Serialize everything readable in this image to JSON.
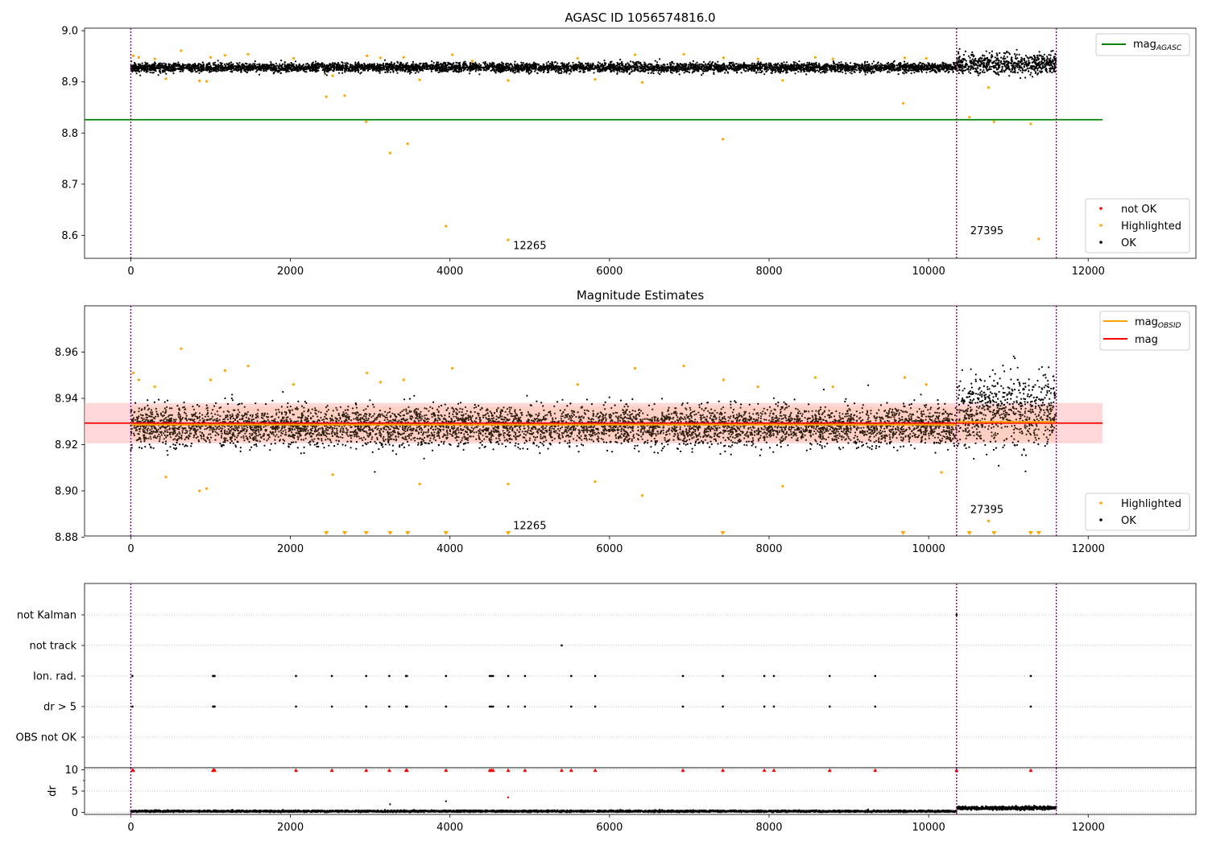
{
  "figure": {
    "main_title": "AGASC ID 1056574816.0",
    "mid_title": "Magnitude Estimates"
  },
  "colors": {
    "ok": "#000000",
    "highlighted": "#ffa500",
    "not_ok": "#ff0000",
    "mag_agasc": "#008000",
    "mag_obsid": "#ffa500",
    "mag": "#ff0000",
    "obs_boundary": "#800080",
    "band": "#ffc0c0"
  },
  "chart_data": [
    {
      "id": "top",
      "type": "scatter",
      "title": "AGASC ID 1056574816.0",
      "xlim": [
        -580,
        13350
      ],
      "ylim": [
        8.555,
        9.005
      ],
      "xticks": [
        0,
        2000,
        4000,
        6000,
        8000,
        10000,
        12000
      ],
      "yticks": [
        8.6,
        8.7,
        8.8,
        8.9,
        9.0
      ],
      "ytick_labels": [
        "8.6",
        "8.7",
        "8.8",
        "8.9",
        "9.0"
      ],
      "obs_boundaries": [
        0,
        10350,
        11600
      ],
      "obs_labels": [
        {
          "text": "12265",
          "x": 5000,
          "y": 8.573
        },
        {
          "text": "27395",
          "x": 10730,
          "y": 8.602
        }
      ],
      "mag_agasc": {
        "y": 8.826,
        "x": [
          -580,
          12180
        ]
      },
      "ok_series": {
        "segments": [
          {
            "x0": 0,
            "x1": 10350,
            "center": 8.928,
            "spread": 0.008
          },
          {
            "x0": 10350,
            "x1": 11600,
            "center": 8.935,
            "spread": 0.018
          }
        ]
      },
      "highlighted": [
        [
          30,
          8.951
        ],
        [
          100,
          8.948
        ],
        [
          300,
          8.945
        ],
        [
          440,
          8.906
        ],
        [
          630,
          8.961
        ],
        [
          860,
          8.902
        ],
        [
          950,
          8.901
        ],
        [
          1000,
          8.948
        ],
        [
          1180,
          8.952
        ],
        [
          1470,
          8.954
        ],
        [
          2040,
          8.946
        ],
        [
          2450,
          8.871
        ],
        [
          2530,
          8.912
        ],
        [
          2680,
          8.873
        ],
        [
          2950,
          8.822
        ],
        [
          2960,
          8.951
        ],
        [
          3130,
          8.947
        ],
        [
          3250,
          8.761
        ],
        [
          3420,
          8.948
        ],
        [
          3470,
          8.779
        ],
        [
          3620,
          8.904
        ],
        [
          3950,
          8.618
        ],
        [
          4030,
          8.953
        ],
        [
          4280,
          8.941
        ],
        [
          4730,
          8.591
        ],
        [
          4730,
          8.903
        ],
        [
          5600,
          8.946
        ],
        [
          5820,
          8.905
        ],
        [
          6320,
          8.953
        ],
        [
          6410,
          8.899
        ],
        [
          6930,
          8.954
        ],
        [
          7420,
          8.788
        ],
        [
          7430,
          8.947
        ],
        [
          7860,
          8.945
        ],
        [
          8170,
          8.903
        ],
        [
          8580,
          8.948
        ],
        [
          8800,
          8.945
        ],
        [
          9680,
          8.858
        ],
        [
          9700,
          8.947
        ],
        [
          9970,
          8.946
        ],
        [
          10510,
          8.831
        ],
        [
          10750,
          8.889
        ],
        [
          10820,
          8.822
        ],
        [
          11280,
          8.818
        ],
        [
          11380,
          8.593
        ]
      ],
      "legend_upper": [
        "mag_AGASC"
      ],
      "legend_lower": [
        "not OK",
        "Highlighted",
        "OK"
      ]
    },
    {
      "id": "middle",
      "type": "scatter",
      "title": "Magnitude Estimates",
      "xlim": [
        -580,
        13350
      ],
      "ylim": [
        8.8805,
        8.98
      ],
      "xticks": [
        0,
        2000,
        4000,
        6000,
        8000,
        10000,
        12000
      ],
      "yticks": [
        8.88,
        8.9,
        8.92,
        8.94,
        8.96
      ],
      "ytick_labels": [
        "8.88",
        "8.90",
        "8.92",
        "8.94",
        "8.96"
      ],
      "obs_boundaries": [
        0,
        10350,
        11600
      ],
      "obs_labels": [
        {
          "text": "12265",
          "x": 5000,
          "y": 8.8835
        },
        {
          "text": "27395",
          "x": 10730,
          "y": 8.8905
        }
      ],
      "mag": {
        "y": 8.9293,
        "band": [
          8.9205,
          8.938
        ],
        "x": [
          -580,
          12180
        ]
      },
      "mag_obsid": [
        {
          "x": [
            0,
            10350
          ],
          "y": 8.9286
        },
        {
          "x": [
            10350,
            11600
          ],
          "y": 8.9298
        }
      ],
      "ok_series": {
        "segments": [
          {
            "x0": 0,
            "x1": 10350,
            "center": 8.928,
            "spread": 0.0075
          },
          {
            "x0": 10350,
            "x1": 11600,
            "center": 8.934,
            "spread": 0.014
          }
        ]
      },
      "highlighted": [
        [
          30,
          8.951
        ],
        [
          100,
          8.948
        ],
        [
          300,
          8.945
        ],
        [
          440,
          8.906
        ],
        [
          630,
          8.9615
        ],
        [
          860,
          8.9
        ],
        [
          950,
          8.901
        ],
        [
          1000,
          8.948
        ],
        [
          1180,
          8.952
        ],
        [
          1470,
          8.954
        ],
        [
          2040,
          8.946
        ],
        [
          2530,
          8.907
        ],
        [
          2960,
          8.951
        ],
        [
          3130,
          8.947
        ],
        [
          3420,
          8.948
        ],
        [
          3620,
          8.903
        ],
        [
          4030,
          8.953
        ],
        [
          4730,
          8.903
        ],
        [
          5600,
          8.946
        ],
        [
          5820,
          8.904
        ],
        [
          6320,
          8.953
        ],
        [
          6410,
          8.898
        ],
        [
          6930,
          8.954
        ],
        [
          7430,
          8.948
        ],
        [
          7860,
          8.945
        ],
        [
          8170,
          8.902
        ],
        [
          8580,
          8.949
        ],
        [
          8800,
          8.945
        ],
        [
          9700,
          8.949
        ],
        [
          9970,
          8.946
        ],
        [
          10160,
          8.908
        ],
        [
          10750,
          8.887
        ]
      ],
      "clipped_low_markers": [
        2450,
        2680,
        2950,
        3250,
        3470,
        3950,
        4730,
        7420,
        9680,
        10510,
        10820,
        11280,
        11380
      ],
      "legend_upper": [
        "mag_OBSID",
        "mag"
      ],
      "legend_lower": [
        "Highlighted",
        "OK"
      ]
    },
    {
      "id": "flags",
      "type": "scatter",
      "xlim": [
        -580,
        13350
      ],
      "ytick_labels": [
        "not Kalman",
        "not track",
        "Ion. rad.",
        "dr > 5",
        "OBS not OK"
      ],
      "obs_boundaries": [
        0,
        10350,
        11600
      ],
      "not_kalman": [
        10350
      ],
      "not_track": [
        5400
      ],
      "ion_rad": [
        20,
        1030,
        1040,
        1050,
        2070,
        2520,
        2950,
        3240,
        3450,
        3460,
        3950,
        4500,
        4520,
        4540,
        4730,
        4940,
        5520,
        5820,
        6920,
        7420,
        7940,
        8060,
        8760,
        9330,
        11280
      ],
      "dr_gt_5": [
        20,
        1030,
        1040,
        1050,
        2070,
        2520,
        2950,
        3240,
        3450,
        3460,
        3950,
        4500,
        4520,
        4540,
        4730,
        4940,
        5520,
        5820,
        6920,
        7420,
        7940,
        8060,
        8760,
        9330,
        11280
      ]
    },
    {
      "id": "dr",
      "type": "scatter",
      "ylabel": "dr",
      "xlim": [
        -580,
        13350
      ],
      "ylim": [
        -0.5,
        10.5
      ],
      "xticks": [
        0,
        2000,
        4000,
        6000,
        8000,
        10000,
        12000
      ],
      "yticks": [
        0,
        5,
        10
      ],
      "obs_boundaries": [
        0,
        10350,
        11600
      ],
      "ok_series": {
        "segments": [
          {
            "x0": 0,
            "x1": 10350,
            "center": 0.25,
            "spread": 0.18
          },
          {
            "x0": 10350,
            "x1": 11600,
            "center": 1.0,
            "spread": 0.35
          }
        ]
      },
      "outliers": [
        [
          3250,
          1.9
        ],
        [
          3950,
          2.6
        ],
        [
          4730,
          3.5
        ]
      ],
      "capped_at_10": [
        20,
        30,
        1030,
        1040,
        1050,
        2070,
        2520,
        2950,
        3240,
        3450,
        3460,
        3950,
        4500,
        4520,
        4540,
        4730,
        4940,
        5400,
        5520,
        5820,
        6920,
        7420,
        7940,
        8060,
        8760,
        9330,
        10350,
        11280
      ]
    }
  ]
}
